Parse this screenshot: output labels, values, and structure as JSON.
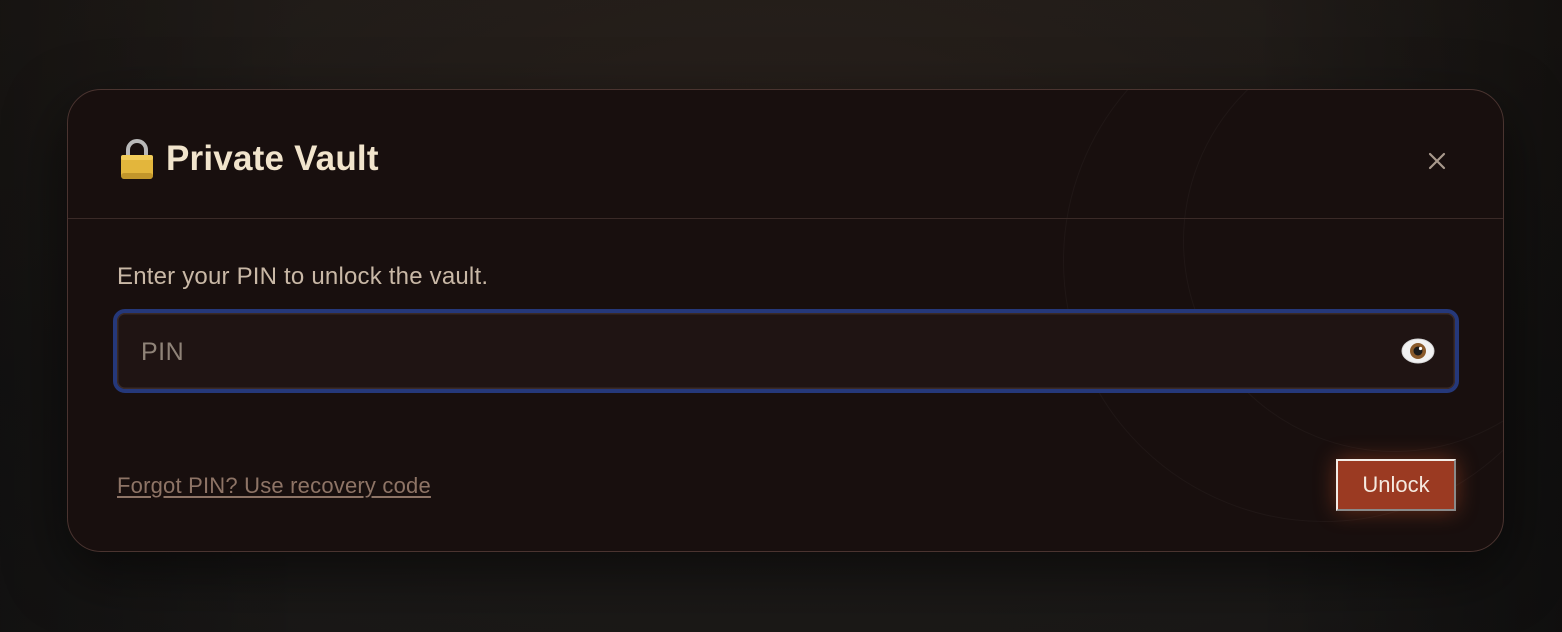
{
  "dialog": {
    "title": "Private Vault",
    "title_icon": "lock-icon",
    "close_icon": "close-icon",
    "prompt": "Enter your PIN to unlock the vault.",
    "pin_field": {
      "placeholder": "PIN",
      "value": "",
      "toggle_icon": "eye-icon"
    },
    "forgot_link": "Forgot PIN? Use recovery code",
    "unlock_label": "Unlock"
  },
  "colors": {
    "title": "#f1e4cc",
    "accent_button": "#9b3a22",
    "focus_ring": "#25387a",
    "modal_bg": "#180f0e"
  }
}
